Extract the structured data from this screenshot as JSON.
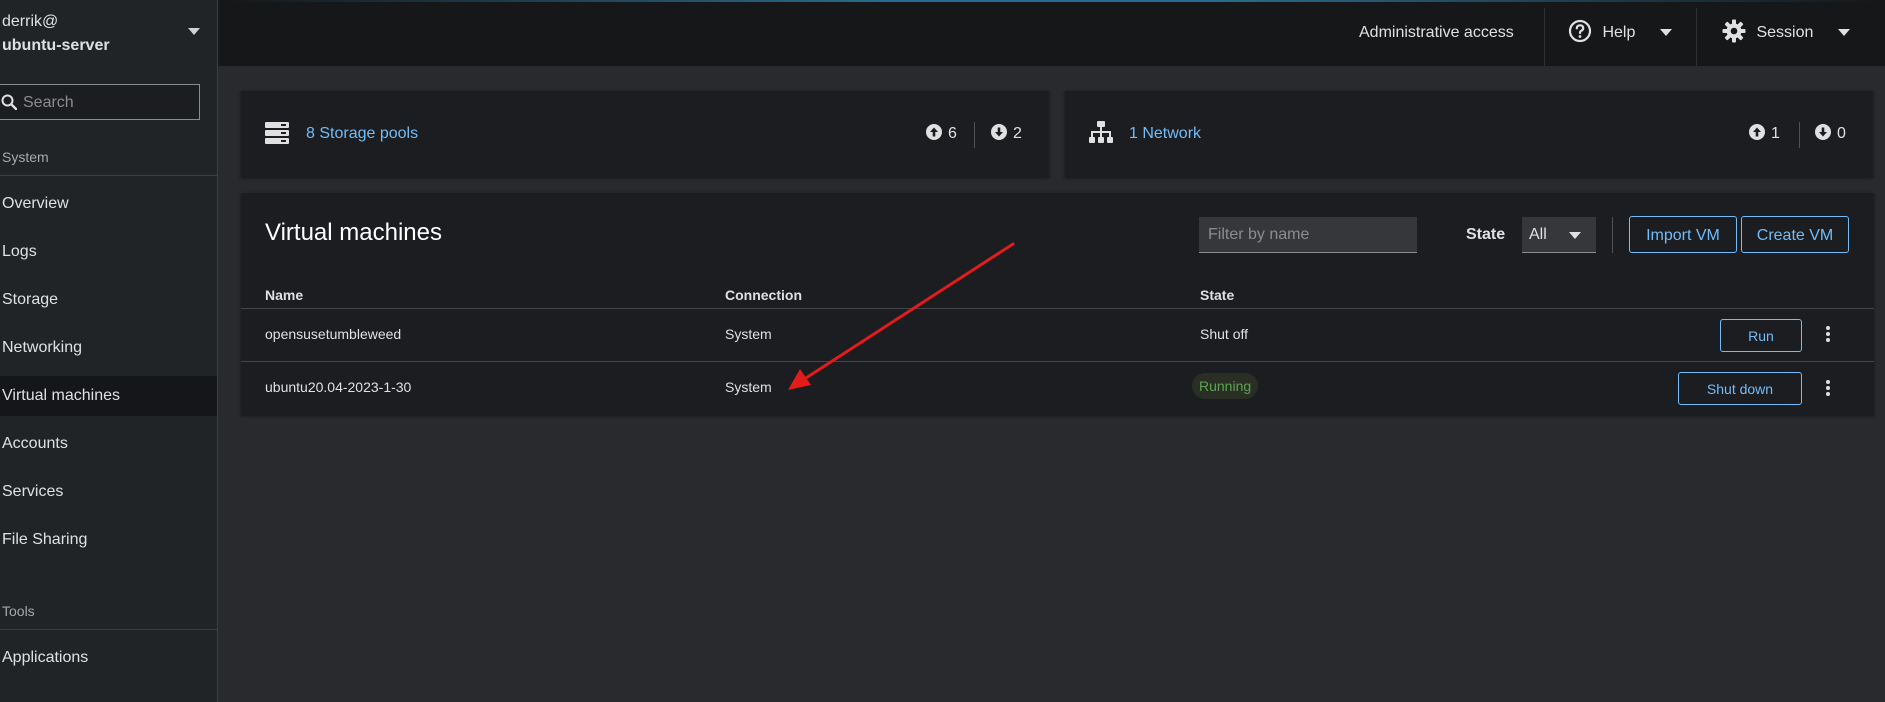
{
  "sidebar": {
    "user": "derrik@",
    "host": "ubuntu-server",
    "search_placeholder": "Search",
    "system_label": "System",
    "items": [
      {
        "label": "Overview"
      },
      {
        "label": "Logs"
      },
      {
        "label": "Storage"
      },
      {
        "label": "Networking"
      },
      {
        "label": "Virtual machines",
        "active": true
      },
      {
        "label": "Accounts"
      },
      {
        "label": "Services"
      },
      {
        "label": "File Sharing"
      }
    ],
    "tools_label": "Tools",
    "tools_items": [
      {
        "label": "Applications"
      }
    ]
  },
  "topbar": {
    "admin_access": "Administrative access",
    "help": "Help",
    "session": "Session"
  },
  "storage_card": {
    "icon": "server-icon",
    "link": "8 Storage pools",
    "up": "6",
    "down": "2"
  },
  "network_card": {
    "icon": "network-icon",
    "link": "1 Network",
    "up": "1",
    "down": "0"
  },
  "vms": {
    "title": "Virtual machines",
    "filter_placeholder": "Filter by name",
    "state_label": "State",
    "state_value": "All",
    "import_label": "Import VM",
    "create_label": "Create VM",
    "columns": [
      "Name",
      "Connection",
      "State"
    ],
    "rows": [
      {
        "name": "opensusetumbleweed",
        "connection": "System",
        "state": "Shut off",
        "action": "Run"
      },
      {
        "name": "ubuntu20.04-2023-1-30",
        "connection": "System",
        "state": "Running",
        "action": "Shut down"
      }
    ]
  },
  "colors": {
    "link": "#73bcf7",
    "running": "#5ba352",
    "annotation_arrow": "#e21b1b"
  }
}
